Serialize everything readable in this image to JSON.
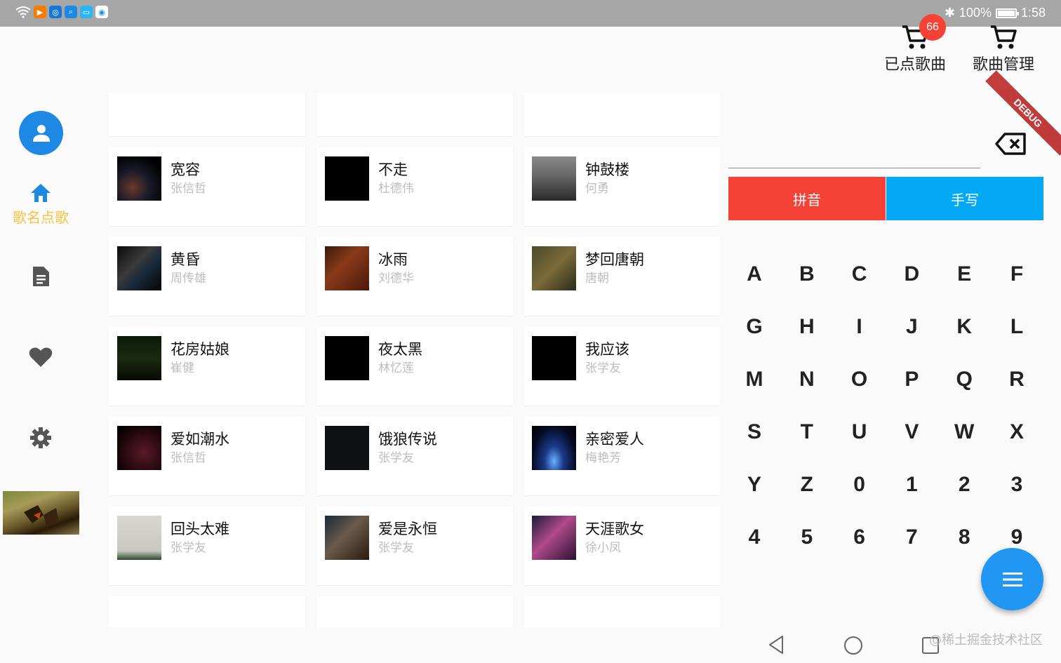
{
  "status_bar": {
    "battery": "100%",
    "battery_level": 1.0,
    "time": "1:58",
    "icons": [
      "wifi-icon",
      "play-app-icon",
      "bulb-app-icon",
      "search-app-icon",
      "screen-app-icon",
      "browser-app-icon",
      "bluetooth-icon",
      "battery-icon"
    ]
  },
  "header": {
    "queued": {
      "label": "已点歌曲",
      "badge": "66",
      "icon": "cart-icon"
    },
    "manage": {
      "label": "歌曲管理",
      "icon": "cart-icon"
    }
  },
  "nav": {
    "avatar_icon": "person-icon",
    "items": [
      {
        "icon": "home-icon",
        "label": "歌名点歌",
        "active": true
      },
      {
        "icon": "document-icon"
      },
      {
        "icon": "heart-icon"
      },
      {
        "icon": "gear-icon"
      }
    ],
    "accent_color": "#f9c23c"
  },
  "songs": [
    {
      "title": "宽容",
      "artist": "张信哲"
    },
    {
      "title": "不走",
      "artist": "杜德伟"
    },
    {
      "title": "钟鼓楼",
      "artist": "何勇"
    },
    {
      "title": "黄昏",
      "artist": "周传雄"
    },
    {
      "title": "冰雨",
      "artist": "刘德华"
    },
    {
      "title": "梦回唐朝",
      "artist": "唐朝"
    },
    {
      "title": "花房姑娘",
      "artist": "崔健"
    },
    {
      "title": "夜太黑",
      "artist": "林忆莲"
    },
    {
      "title": "我应该",
      "artist": "张学友"
    },
    {
      "title": "爱如潮水",
      "artist": "张信哲"
    },
    {
      "title": "饿狼传说",
      "artist": "张学友"
    },
    {
      "title": "亲密爱人",
      "artist": "梅艳芳"
    },
    {
      "title": "回头太难",
      "artist": "张学友"
    },
    {
      "title": "爱是永恒",
      "artist": "张学友"
    },
    {
      "title": "天涯歌女",
      "artist": "徐小凤"
    }
  ],
  "keyboard": {
    "tabs": [
      {
        "label": "拼音",
        "color": "#f44336"
      },
      {
        "label": "手写",
        "color": "#03a9f4"
      }
    ],
    "keys": [
      "A",
      "B",
      "C",
      "D",
      "E",
      "F",
      "G",
      "H",
      "I",
      "J",
      "K",
      "L",
      "M",
      "N",
      "O",
      "P",
      "Q",
      "R",
      "S",
      "T",
      "U",
      "V",
      "W",
      "X",
      "Y",
      "Z",
      "0",
      "1",
      "2",
      "3",
      "4",
      "5",
      "6",
      "7",
      "8",
      "9"
    ],
    "backspace_icon": "backspace-icon"
  },
  "debug_banner": "DEBUG",
  "fab_icon": "menu-icon",
  "system_nav": [
    "back-icon",
    "home-circle-icon",
    "recents-icon"
  ],
  "watermark": "@稀土掘金技术社区"
}
